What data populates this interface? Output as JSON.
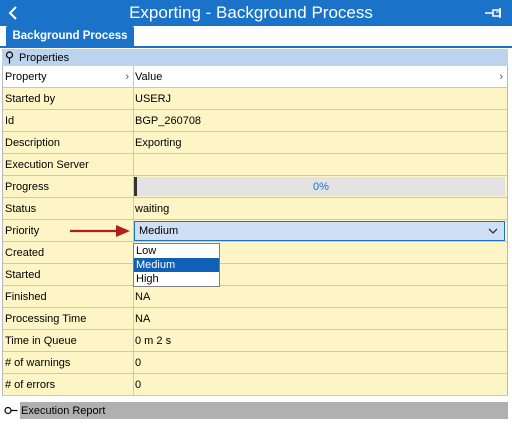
{
  "window": {
    "title": "Exporting  - Background Process",
    "back_icon": "back-chevron-icon",
    "pin_icon": "pin-icon"
  },
  "tabs": [
    {
      "label": "Background Process",
      "active": true
    }
  ],
  "properties_section": {
    "title": "Properties",
    "columns": {
      "property": "Property",
      "value": "Value"
    },
    "rows": [
      {
        "property": "Started by",
        "value": "USERJ"
      },
      {
        "property": "Id",
        "value": "BGP_260708"
      },
      {
        "property": "Description",
        "value": "Exporting"
      },
      {
        "property": "Execution Server",
        "value": ""
      },
      {
        "property": "Progress",
        "value": "0%",
        "progress_fraction": 0
      },
      {
        "property": "Status",
        "value": "waiting"
      },
      {
        "property": "Priority",
        "value": "Medium"
      },
      {
        "property": "Created",
        "value": ""
      },
      {
        "property": "Started",
        "value": ""
      },
      {
        "property": "Finished",
        "value": "NA"
      },
      {
        "property": "Processing Time",
        "value": "NA"
      },
      {
        "property": "Time in Queue",
        "value": "0 m 2 s"
      },
      {
        "property": "# of warnings",
        "value": "0"
      },
      {
        "property": "# of errors",
        "value": "0"
      }
    ]
  },
  "priority_dropdown": {
    "options": [
      "Low",
      "Medium",
      "High"
    ],
    "selected": "Medium"
  },
  "execution_report_section": {
    "title": "Execution Report",
    "collapsed": true
  },
  "colors": {
    "accent": "#1a73c8",
    "row_background": "#fdf5c6",
    "section_header": "#bcd3ee",
    "annotation_arrow": "#b02020"
  }
}
